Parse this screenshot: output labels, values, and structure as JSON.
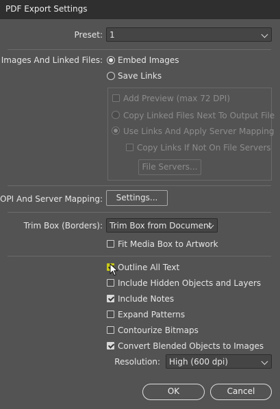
{
  "window": {
    "title": "PDF Export Settings"
  },
  "preset": {
    "label": "Preset:",
    "value": "1"
  },
  "images": {
    "label": "Images And Linked Files:",
    "embed": "Embed Images",
    "save_links": "Save Links",
    "add_preview": "Add Preview (max 72 DPI)",
    "copy_linked": "Copy Linked Files Next To Output File",
    "use_links": "Use Links And Apply Server Mapping",
    "copy_links_if": "Copy Links If Not On File Servers",
    "file_servers": "File Servers..."
  },
  "opi": {
    "label": "OPI And Server Mapping:",
    "settings": "Settings..."
  },
  "trim": {
    "label": "Trim Box (Borders):",
    "value": "Trim Box from Document",
    "fit_media": "Fit Media Box to Artwork"
  },
  "options": {
    "outline_text": "Outline All Text",
    "hidden_objects": "Include Hidden Objects and Layers",
    "include_notes": "Include Notes",
    "expand_patterns": "Expand Patterns",
    "contourize": "Contourize Bitmaps",
    "convert_blended": "Convert Blended Objects to Images"
  },
  "resolution": {
    "label": "Resolution:",
    "value": "High (600 dpi)"
  },
  "buttons": {
    "ok": "OK",
    "cancel": "Cancel"
  }
}
